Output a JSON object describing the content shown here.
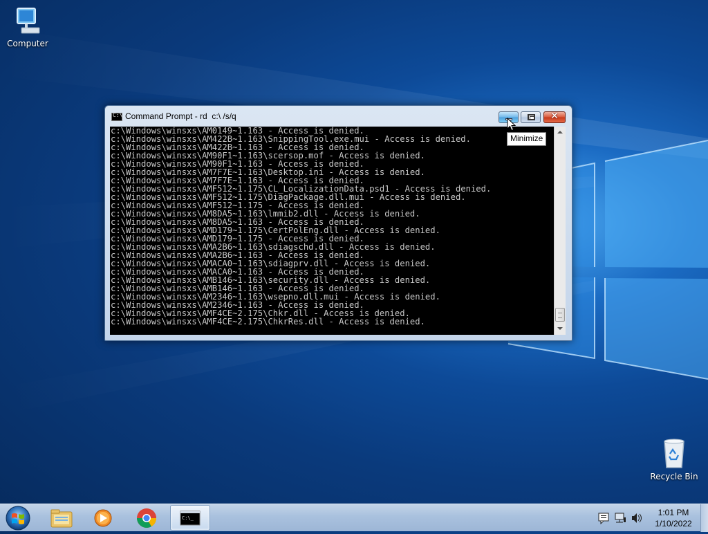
{
  "desktop": {
    "icons": {
      "computer": "Computer",
      "recycle_bin": "Recycle Bin"
    }
  },
  "window": {
    "title": "Command Prompt - rd  c:\\ /s/q",
    "console_fg": "#c8c8c8",
    "console_bg": "#000000",
    "lines": [
      "c:\\Windows\\winsxs\\AM0149~1.163 - Access is denied.",
      "c:\\Windows\\winsxs\\AM422B~1.163\\SnippingTool.exe.mui - Access is denied.",
      "c:\\Windows\\winsxs\\AM422B~1.163 - Access is denied.",
      "c:\\Windows\\winsxs\\AM90F1~1.163\\scersop.mof - Access is denied.",
      "c:\\Windows\\winsxs\\AM90F1~1.163 - Access is denied.",
      "c:\\Windows\\winsxs\\AM7F7E~1.163\\Desktop.ini - Access is denied.",
      "c:\\Windows\\winsxs\\AM7F7E~1.163 - Access is denied.",
      "c:\\Windows\\winsxs\\AMF512~1.175\\CL_LocalizationData.psd1 - Access is denied.",
      "c:\\Windows\\winsxs\\AMF512~1.175\\DiagPackage.dll.mui - Access is denied.",
      "c:\\Windows\\winsxs\\AMF512~1.175 - Access is denied.",
      "c:\\Windows\\winsxs\\AM8DA5~1.163\\lmmib2.dll - Access is denied.",
      "c:\\Windows\\winsxs\\AM8DA5~1.163 - Access is denied.",
      "c:\\Windows\\winsxs\\AMD179~1.175\\CertPolEng.dll - Access is denied.",
      "c:\\Windows\\winsxs\\AMD179~1.175 - Access is denied.",
      "c:\\Windows\\winsxs\\AMA2B6~1.163\\sdiagschd.dll - Access is denied.",
      "c:\\Windows\\winsxs\\AMA2B6~1.163 - Access is denied.",
      "c:\\Windows\\winsxs\\AMACA0~1.163\\sdiagprv.dll - Access is denied.",
      "c:\\Windows\\winsxs\\AMACA0~1.163 - Access is denied.",
      "c:\\Windows\\winsxs\\AMB146~1.163\\security.dll - Access is denied.",
      "c:\\Windows\\winsxs\\AMB146~1.163 - Access is denied.",
      "c:\\Windows\\winsxs\\AM2346~1.163\\wsepno.dll.mui - Access is denied.",
      "c:\\Windows\\winsxs\\AM2346~1.163 - Access is denied.",
      "c:\\Windows\\winsxs\\AMF4CE~2.175\\Chkr.dll - Access is denied.",
      "c:\\Windows\\winsxs\\AMF4CE~2.175\\ChkrRes.dll - Access is denied."
    ]
  },
  "tooltip": {
    "text": "Minimize"
  },
  "taskbar": {
    "pinned": [
      "start-orb",
      "file-explorer-icon",
      "media-player-icon",
      "chrome-icon",
      "command-prompt-icon"
    ],
    "clock": {
      "time": "1:01 PM",
      "date": "1/10/2022"
    }
  }
}
